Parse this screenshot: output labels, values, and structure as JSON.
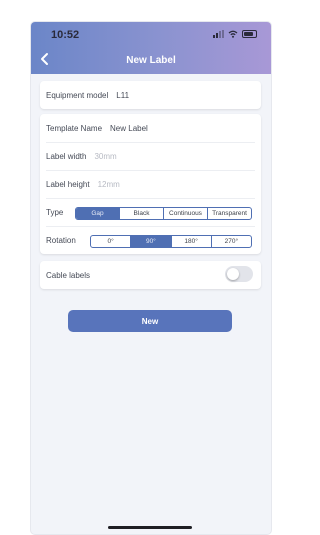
{
  "status_bar": {
    "time": "10:52"
  },
  "nav": {
    "title": "New Label",
    "back_icon": "chevron-left-icon"
  },
  "equipment": {
    "label": "Equipment model",
    "value": "L11"
  },
  "template": {
    "name_label": "Template Name",
    "name_value": "New Label",
    "width_label": "Label width",
    "width_placeholder": "30mm",
    "height_label": "Label height",
    "height_placeholder": "12mm"
  },
  "type": {
    "label": "Type",
    "options": [
      "Gap",
      "Black",
      "Continuous",
      "Transparent"
    ],
    "selected": "Gap"
  },
  "rotation": {
    "label": "Rotation",
    "options": [
      "0°",
      "90°",
      "180°",
      "270°"
    ],
    "selected": "90°"
  },
  "cable": {
    "label": "Cable labels",
    "enabled": false
  },
  "actions": {
    "new_label": "New"
  },
  "colors": {
    "accent": "#4f6fb3",
    "header_start": "#6b86c8",
    "header_end": "#a898d6",
    "background": "#f2f4f9"
  }
}
